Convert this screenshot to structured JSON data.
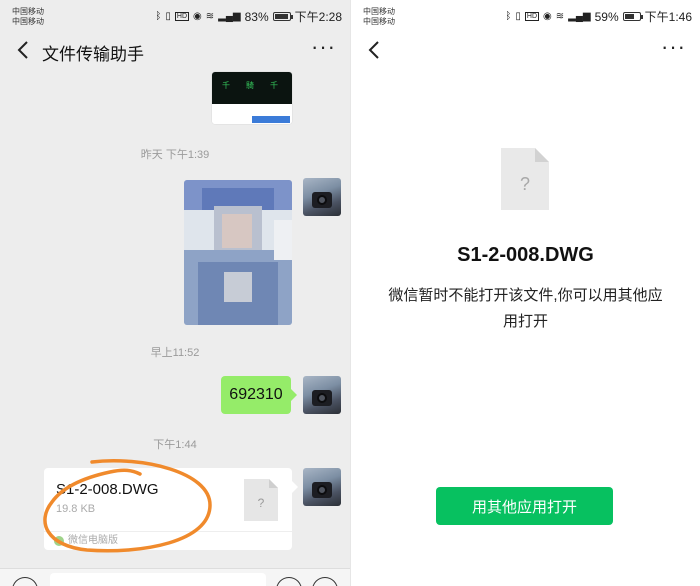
{
  "left": {
    "status": {
      "carrier_line1": "中国移动",
      "carrier_line2": "中国移动",
      "battery": "83%",
      "time": "下午2:28",
      "battery_level": 0.83
    },
    "nav": {
      "title": "文件传输助手",
      "more": "···"
    },
    "chat": {
      "timestamps": [
        "昨天 下午1:39",
        "早上11:52",
        "下午1:44"
      ],
      "text_message": "692310",
      "file": {
        "name": "S1-2-008.DWG",
        "size": "19.8 KB",
        "source": "微信电脑版",
        "doc_glyph": "?"
      }
    }
  },
  "right": {
    "status": {
      "carrier_line1": "中国移动",
      "carrier_line2": "中国移动",
      "battery": "59%",
      "time": "下午1:46",
      "battery_level": 0.59
    },
    "nav": {
      "more": "···"
    },
    "doc_glyph": "?",
    "file_name": "S1-2-008.DWG",
    "message": "微信暂时不能打开该文件,你可以用其他应用打开",
    "open_button": "用其他应用打开"
  },
  "colors": {
    "accent": "#07c160",
    "bubble_green": "#95ec69",
    "chat_bg": "#ededed"
  },
  "icons": [
    "bluetooth-icon",
    "vibrate-icon",
    "hd-icon",
    "eye-icon",
    "wifi-icon",
    "signal-icon",
    "battery-icon",
    "back-arrow-icon",
    "more-icon",
    "file-icon",
    "voice-icon",
    "emoji-icon",
    "plus-icon"
  ]
}
